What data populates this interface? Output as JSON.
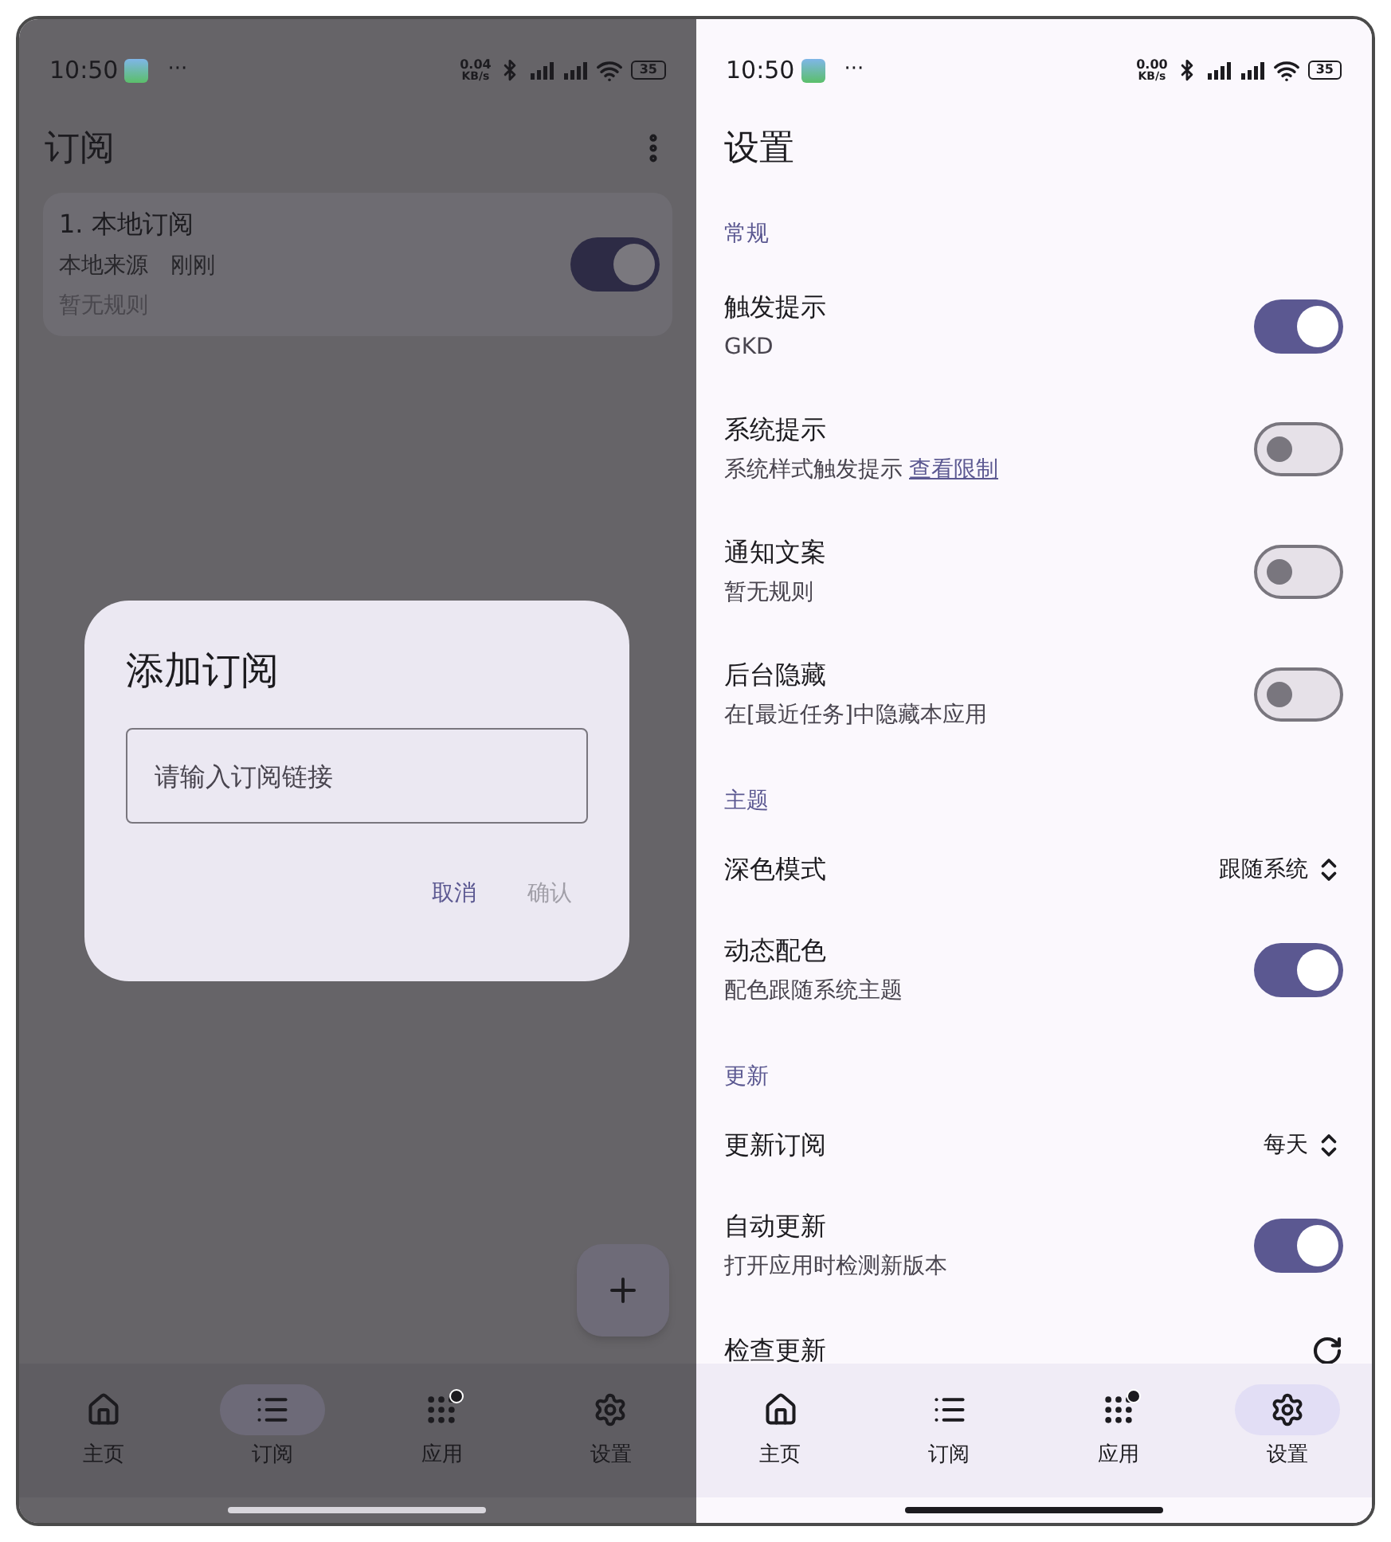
{
  "left_screen": {
    "status_bar": {
      "time": "10:50",
      "overflow": "···",
      "speed_value": "0.04",
      "speed_unit": "KB/s",
      "battery": "35"
    },
    "title": "订阅",
    "subscriptions": [
      {
        "name": "1. 本地订阅",
        "source": "本地来源",
        "updated": "刚刚",
        "rules": "暂无规则",
        "on": true
      }
    ],
    "dialog": {
      "title": "添加订阅",
      "placeholder": "请输入订阅链接",
      "buttons": [
        {
          "label": "取消",
          "disabled": false
        },
        {
          "label": "确认",
          "disabled": true
        }
      ]
    },
    "nav": [
      {
        "label": "主页",
        "selected": false,
        "badge": false
      },
      {
        "label": "订阅",
        "selected": true,
        "badge": false
      },
      {
        "label": "应用",
        "selected": false,
        "badge": true
      },
      {
        "label": "设置",
        "selected": false,
        "badge": false
      }
    ]
  },
  "right_screen": {
    "status_bar": {
      "time": "10:50",
      "overflow": "···",
      "speed_value": "0.00",
      "speed_unit": "KB/s",
      "battery": "35"
    },
    "title": "设置",
    "sections": [
      {
        "header": "常规",
        "items": [
          {
            "kind": "switch",
            "title": "触发提示",
            "subtitle": "GKD",
            "on": true
          },
          {
            "kind": "switch",
            "title": "系统提示",
            "subtitle": "系统样式触发提示",
            "link": "查看限制",
            "on": false
          },
          {
            "kind": "switch",
            "title": "通知文案",
            "subtitle": "暂无规则",
            "on": false
          },
          {
            "kind": "switch",
            "title": "后台隐藏",
            "subtitle": "在[最近任务]中隐藏本应用",
            "on": false
          }
        ]
      },
      {
        "header": "主题",
        "items": [
          {
            "kind": "select",
            "title": "深色模式",
            "value": "跟随系统"
          },
          {
            "kind": "switch",
            "title": "动态配色",
            "subtitle": "配色跟随系统主题",
            "on": true
          }
        ]
      },
      {
        "header": "更新",
        "items": [
          {
            "kind": "select",
            "title": "更新订阅",
            "value": "每天"
          },
          {
            "kind": "switch",
            "title": "自动更新",
            "subtitle": "打开应用时检测新版本",
            "on": true
          },
          {
            "kind": "action",
            "title": "检查更新"
          }
        ]
      }
    ],
    "nav": [
      {
        "label": "主页",
        "selected": false,
        "badge": false
      },
      {
        "label": "订阅",
        "selected": false,
        "badge": false
      },
      {
        "label": "应用",
        "selected": false,
        "badge": true
      },
      {
        "label": "设置",
        "selected": true,
        "badge": false
      }
    ]
  }
}
